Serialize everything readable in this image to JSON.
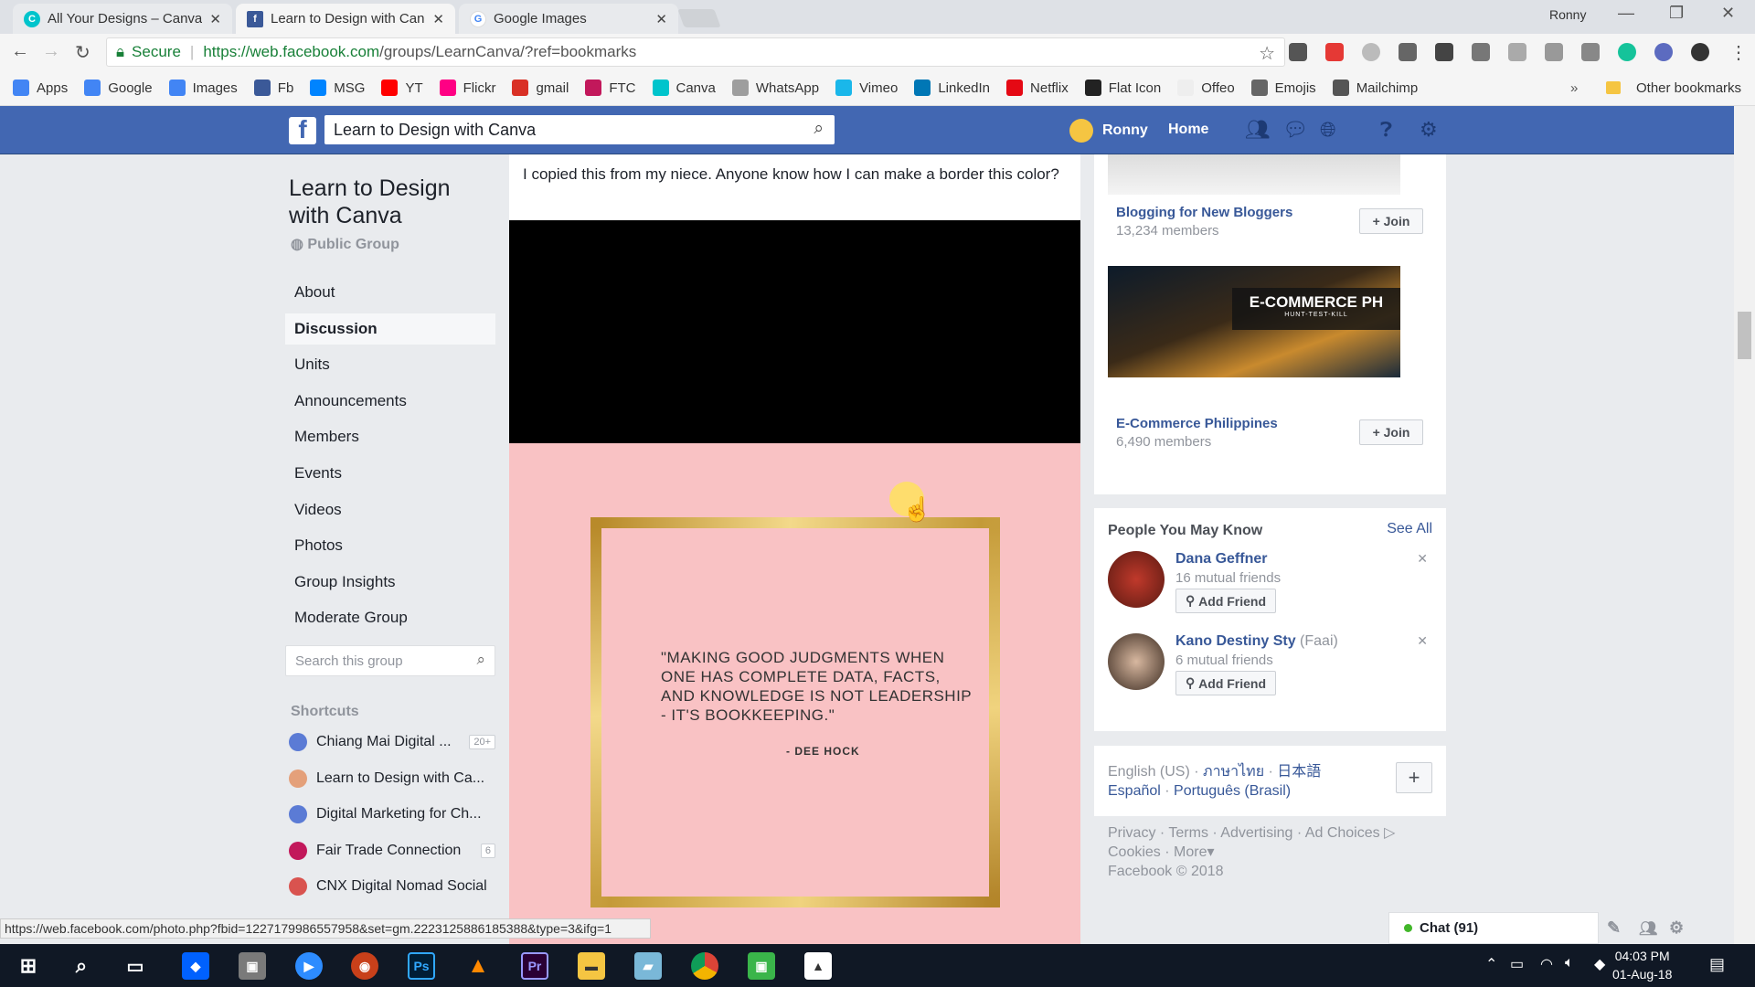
{
  "browser": {
    "tabs": [
      {
        "title": "All Your Designs – Canva",
        "favicon": "canva-icon",
        "active": false
      },
      {
        "title": "Learn to Design with Can",
        "favicon": "facebook-icon",
        "active": true
      },
      {
        "title": "Google Images",
        "favicon": "google-icon",
        "active": false
      }
    ],
    "profile_name": "Ronny",
    "address": {
      "secure_label": "Secure",
      "url_origin": "https://web.facebook.com",
      "url_path": "/groups/LearnCanva/?ref=bookmarks"
    },
    "bookmarks": [
      {
        "label": "Apps",
        "icon": "apps-grid-icon",
        "color": "#4285f4"
      },
      {
        "label": "Google",
        "icon": "google-icon",
        "color": "#4285f4"
      },
      {
        "label": "Images",
        "icon": "google-icon",
        "color": "#4285f4"
      },
      {
        "label": "Fb",
        "icon": "facebook-icon",
        "color": "#3b5998"
      },
      {
        "label": "MSG",
        "icon": "messenger-icon",
        "color": "#0084ff"
      },
      {
        "label": "YT",
        "icon": "youtube-icon",
        "color": "#ff0000"
      },
      {
        "label": "Flickr",
        "icon": "flickr-icon",
        "color": "#ff0084"
      },
      {
        "label": "gmail",
        "icon": "gmail-icon",
        "color": "#d93025"
      },
      {
        "label": "FTC",
        "icon": "ftc-icon",
        "color": "#c2185b"
      },
      {
        "label": "Canva",
        "icon": "canva-icon",
        "color": "#00c4cc"
      },
      {
        "label": "WhatsApp",
        "icon": "document-icon",
        "color": "#9e9e9e"
      },
      {
        "label": "Vimeo",
        "icon": "vimeo-icon",
        "color": "#1ab7ea"
      },
      {
        "label": "LinkedIn",
        "icon": "linkedin-icon",
        "color": "#0077b5"
      },
      {
        "label": "Netflix",
        "icon": "netflix-icon",
        "color": "#e50914"
      },
      {
        "label": "Flat Icon",
        "icon": "flaticon-icon",
        "color": "#222222"
      },
      {
        "label": "Offeo",
        "icon": "offeo-icon",
        "color": "#eeeeee"
      },
      {
        "label": "Emojis",
        "icon": "emoji-icon",
        "color": "#666666"
      },
      {
        "label": "Mailchimp",
        "icon": "mailchimp-icon",
        "color": "#555555"
      }
    ],
    "overflow_label": "»",
    "other_bookmarks": "Other bookmarks",
    "status_url": "https://web.facebook.com/photo.php?fbid=1227179986557958&set=gm.2223125886185388&type=3&ifg=1"
  },
  "fb": {
    "search_value": "Learn to Design with Canva",
    "user_name": "Ronny",
    "home_label": "Home",
    "brand_color": "#4267b2"
  },
  "group": {
    "title": "Learn to Design with Canva",
    "type": "Public Group",
    "nav": [
      {
        "label": "About",
        "selected": false
      },
      {
        "label": "Discussion",
        "selected": true
      },
      {
        "label": "Units",
        "selected": false
      },
      {
        "label": "Announcements",
        "selected": false
      },
      {
        "label": "Members",
        "selected": false
      },
      {
        "label": "Events",
        "selected": false
      },
      {
        "label": "Videos",
        "selected": false
      },
      {
        "label": "Photos",
        "selected": false
      },
      {
        "label": "Group Insights",
        "selected": false
      },
      {
        "label": "Moderate Group",
        "selected": false
      }
    ],
    "search_placeholder": "Search this group",
    "shortcuts_label": "Shortcuts",
    "shortcuts": [
      {
        "label": "Chiang Mai Digital ...",
        "badge": "20+",
        "color": "#5b7bd5"
      },
      {
        "label": "Learn to Design with Ca...",
        "badge": "",
        "color": "#e4a07a"
      },
      {
        "label": "Digital Marketing for Ch...",
        "badge": "",
        "color": "#5b7bd5"
      },
      {
        "label": "Fair Trade Connection",
        "badge": "6",
        "color": "#c2185b"
      },
      {
        "label": "CNX Digital Nomad Social",
        "badge": "",
        "color": "#d9534f"
      }
    ]
  },
  "post": {
    "text": "I copied this from my niece. Anyone know how I can make a border this color?",
    "quote": "\"MAKING GOOD JUDGMENTS WHEN ONE HAS COMPLETE DATA, FACTS, AND KNOWLEDGE IS NOT LEADERSHIP - IT'S BOOKKEEPING.\"",
    "quote_author": "- DEE HOCK",
    "image_bg": "#f9c2c4",
    "border_gold": "#d4ab3c"
  },
  "suggested_groups": [
    {
      "name": "Blogging for New Bloggers",
      "members": "13,234 members",
      "join": "+ Join"
    },
    {
      "name": "E-Commerce Philippines",
      "members": "6,490 members",
      "join": "+ Join",
      "image_title": "E-COMMERCE PH",
      "image_subtitle": "HUNT-TEST-KILL"
    }
  ],
  "pymk": {
    "header": "People You May Know",
    "see_all": "See All",
    "people": [
      {
        "name": "Dana Geffner",
        "alt": "",
        "mutual": "16 mutual friends",
        "button": "Add Friend"
      },
      {
        "name": "Kano Destiny Sty",
        "alt": "(Faai)",
        "mutual": "6 mutual friends",
        "button": "Add Friend"
      }
    ]
  },
  "languages": {
    "current": "English (US)",
    "others": [
      "ภาษาไทย",
      "日本語",
      "Español",
      "Português (Brasil)"
    ]
  },
  "footer": {
    "links": [
      "Privacy",
      "Terms",
      "Advertising",
      "Ad Choices",
      "Cookies",
      "More"
    ],
    "copyright": "Facebook © 2018"
  },
  "chat": {
    "label": "Chat (91)"
  },
  "taskbar": {
    "time": "04:03 PM",
    "date": "01-Aug-18"
  }
}
